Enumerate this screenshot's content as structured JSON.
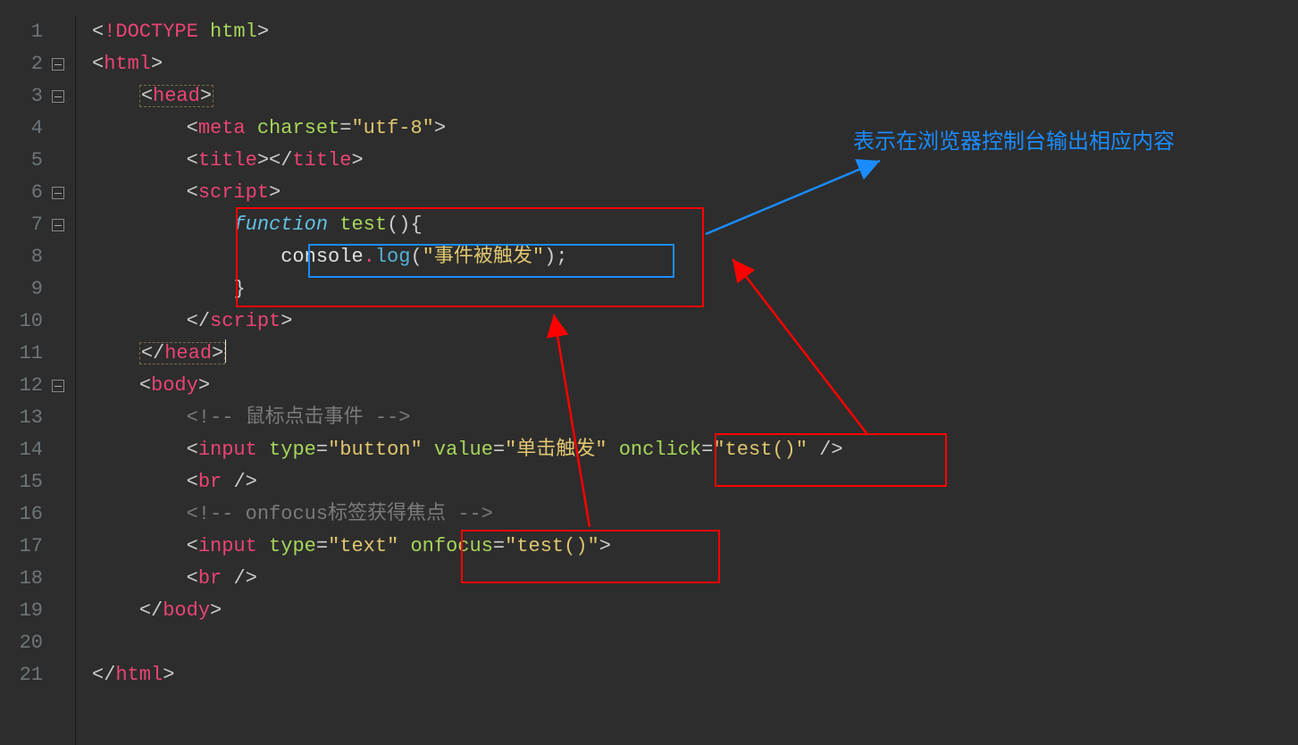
{
  "annotation": "表示在浏览器控制台输出相应内容",
  "gutter": {
    "lines": [
      1,
      2,
      3,
      4,
      5,
      6,
      7,
      8,
      9,
      10,
      11,
      12,
      13,
      14,
      15,
      16,
      17,
      18,
      19,
      20,
      21
    ],
    "fold_lines": [
      2,
      3,
      6,
      7,
      12
    ]
  },
  "code": {
    "l1": {
      "lt": "<",
      "doctype_bang": "!",
      "doctype": "DOCTYPE",
      "space": " ",
      "html": "html",
      "gt": ">"
    },
    "l2": {
      "lt": "<",
      "tag": "html",
      "gt": ">"
    },
    "l3": {
      "lt": "<",
      "tag": "head",
      "gt": ">"
    },
    "l4": {
      "lt": "<",
      "tag": "meta",
      "sp": " ",
      "attr": "charset",
      "eq": "=",
      "val": "\"utf-8\"",
      "gt": ">"
    },
    "l5": {
      "lt": "<",
      "tag": "title",
      "gt": ">",
      "lt2": "</",
      "tag2": "title",
      "gt2": ">"
    },
    "l6": {
      "lt": "<",
      "tag": "script",
      "gt": ">"
    },
    "l7": {
      "kw": "function",
      "sp": " ",
      "fn": "test",
      "paren": "(){"
    },
    "l8": {
      "obj": "console",
      "dot": ".",
      "method": "log",
      "open": "(",
      "str": "\"事件被触发\"",
      "close": ");"
    },
    "l9": {
      "brace": "}"
    },
    "l10": {
      "lt": "</",
      "tag": "script",
      "gt": ">"
    },
    "l11": {
      "lt": "</",
      "tag": "head",
      "gt": ">"
    },
    "l12": {
      "lt": "<",
      "tag": "body",
      "gt": ">"
    },
    "l13": {
      "comment": "<!-- 鼠标点击事件 -->"
    },
    "l14": {
      "lt": "<",
      "tag": "input",
      "sp1": " ",
      "attr1": "type",
      "eq": "=",
      "val1": "\"button\"",
      "sp2": " ",
      "attr2": "value",
      "val2": "\"单击触发\"",
      "sp3": " ",
      "attr3": "onclick",
      "val3": "\"test()\"",
      "sp4": " ",
      "slash": "/",
      "gt": ">"
    },
    "l15": {
      "lt": "<",
      "tag": "br",
      "sp": " ",
      "slash": "/",
      "gt": ">"
    },
    "l16": {
      "comment": "<!-- onfocus标签获得焦点 -->"
    },
    "l17": {
      "lt": "<",
      "tag": "input",
      "sp1": " ",
      "attr1": "type",
      "eq": "=",
      "val1": "\"text\"",
      "sp2": " ",
      "attr2": "onfocus",
      "val2": "\"test()\"",
      "gt": ">"
    },
    "l18": {
      "lt": "<",
      "tag": "br",
      "sp": " ",
      "slash": "/",
      "gt": ">"
    },
    "l19": {
      "lt": "</",
      "tag": "body",
      "gt": ">"
    },
    "l21": {
      "lt": "</",
      "tag": "html",
      "gt": ">"
    }
  }
}
